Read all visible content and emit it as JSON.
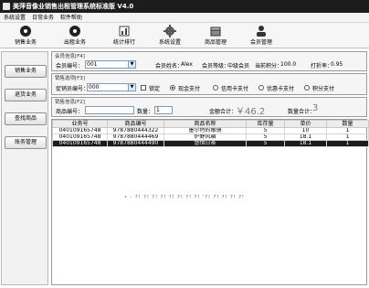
{
  "window": {
    "title": "美萍音像业销售出租管理系统标准版 V4.0"
  },
  "menu": [
    "系统设置",
    "日常业务",
    "软件帮助"
  ],
  "toolbar": {
    "items": [
      {
        "label": "销售业务",
        "icon": "cd-icon"
      },
      {
        "label": "出租业务",
        "icon": "cd-icon"
      },
      {
        "label": "统计排行",
        "icon": "chart-icon"
      },
      {
        "label": "系统设置",
        "icon": "gear-icon"
      },
      {
        "label": "商品管理",
        "icon": "box-icon"
      },
      {
        "label": "会员管理",
        "icon": "member-icon"
      }
    ]
  },
  "sidebar": {
    "items": [
      {
        "label": "销售业务"
      },
      {
        "label": "退货业务"
      },
      {
        "label": "查找商品"
      },
      {
        "label": "账务管理"
      }
    ]
  },
  "member": {
    "group_title": "会员信息[F4]",
    "id_label": "会员编号：",
    "id_value": "001",
    "name_label": "会员姓名：",
    "name_value": "Alex",
    "level_label": "会员等级：",
    "level_value": "中级会员",
    "points_label": "当前积分：",
    "points_value": "100.0",
    "discount_label": "打折率：",
    "discount_value": "0.95"
  },
  "sale_options": {
    "group_title": "销售选项[F3]",
    "staff_label": "促销员编号：",
    "staff_value": "000",
    "lock_label": "锁定",
    "payment_options": [
      {
        "label": "现金支付",
        "selected": true
      },
      {
        "label": "信用卡支付",
        "selected": false
      },
      {
        "label": "优惠卡支付",
        "selected": false
      },
      {
        "label": "积分支付",
        "selected": false
      }
    ]
  },
  "product": {
    "group_title": "销售信息[F2]",
    "code_label": "商品编号：",
    "code_value": "",
    "qty_label": "数量：",
    "qty_value": "1",
    "amount_label": "金额合计：",
    "amount_value": "￥46.2",
    "count_label": "数量合计：",
    "count_value": "3"
  },
  "table": {
    "columns": [
      "业务号",
      "商品编号",
      "商品名称",
      "库存量",
      "单价",
      "数量"
    ],
    "rows": [
      [
        "040109165748",
        "9787880444322",
        "墨尔特的眼镜",
        "5",
        "10",
        "1"
      ],
      [
        "040109165748",
        "9787880444469",
        "炉野风箱",
        "5",
        "18.1",
        "1"
      ],
      [
        "040109165748",
        "9787880444490",
        "悠悟日茶",
        "5",
        "18.1",
        "1"
      ]
    ],
    "selected_row": 2
  },
  "overlay_text": "• - ?! ?! ?! ?! ?! ?! ?! ?! '?! ?! ?! ?! ?!"
}
